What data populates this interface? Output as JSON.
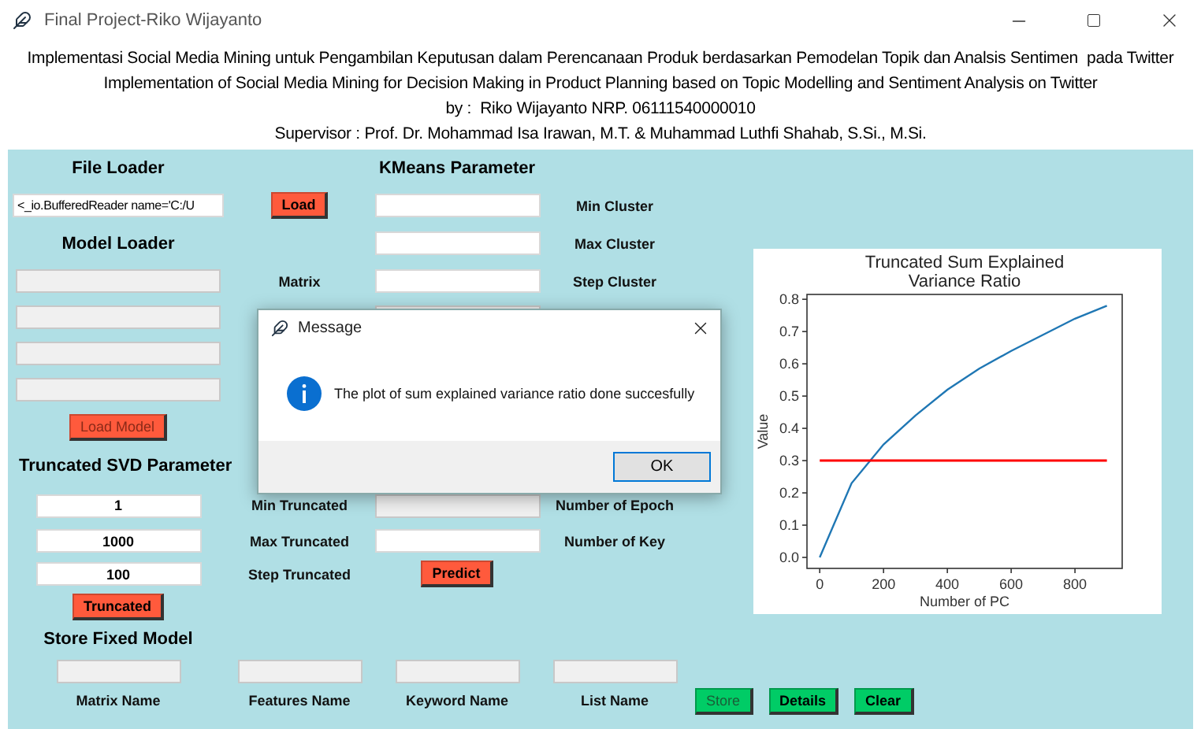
{
  "window": {
    "title": "Final Project-Riko Wijayanto"
  },
  "header": [
    "Implementasi Social Media Mining untuk Pengambilan Keputusan dalam Perencanaan Produk berdasarkan Pemodelan Topik dan Analsis Sentimen  pada Twitter",
    "Implementation of Social Media Mining for Decision Making in Product Planning based on Topic Modelling and Sentiment Analysis on Twitter",
    "by :  Riko Wijayanto NRP. 06111540000010",
    "Supervisor : Prof. Dr. Mohammad Isa Irawan, M.T. & Muhammad Luthfi Shahab, S.Si., M.Si."
  ],
  "file_loader": {
    "heading": "File Loader",
    "path_value": "<_io.BufferedReader name='C:/U",
    "load_button": {
      "label": "Load",
      "disabled": false
    }
  },
  "model_loader": {
    "heading": "Model Loader",
    "fields": [
      {
        "disabled": true
      },
      {
        "disabled": true
      },
      {
        "disabled": true
      },
      {
        "disabled": true
      }
    ],
    "load_button": {
      "label": "Load Model",
      "disabled": true
    }
  },
  "kmeans": {
    "heading": "KMeans Parameter",
    "matrix_label": "Matrix",
    "fields": [
      {
        "label": "Min Cluster",
        "disabled": false
      },
      {
        "label": "Max Cluster",
        "disabled": false
      },
      {
        "label": "Step Cluster",
        "disabled": false
      },
      {
        "disabled": true
      },
      {
        "label": "Number of Epoch",
        "disabled": true
      },
      {
        "label": "Number of Key",
        "disabled": false
      }
    ],
    "predict_button": {
      "label": "Predict",
      "disabled": false
    }
  },
  "truncated_svd": {
    "heading": "Truncated SVD Parameter",
    "rows": [
      {
        "value": "1",
        "label": "Min Truncated"
      },
      {
        "value": "1000",
        "label": "Max Truncated"
      },
      {
        "value": "100",
        "label": "Step Truncated"
      }
    ],
    "button": {
      "label": "Truncated",
      "disabled": false
    }
  },
  "store_fixed_model": {
    "heading": "Store Fixed Model",
    "fields": [
      {
        "label": "Matrix Name",
        "disabled": true
      },
      {
        "label": "Features Name",
        "disabled": true
      },
      {
        "label": "Keyword Name",
        "disabled": true
      },
      {
        "label": "List Name",
        "disabled": true
      }
    ],
    "buttons": [
      {
        "label": "Store",
        "disabled": true
      },
      {
        "label": "Details",
        "disabled": false
      },
      {
        "label": "Clear",
        "disabled": false
      }
    ]
  },
  "chart_data": {
    "type": "line",
    "title": "Truncated Sum Explained Variance Ratio",
    "xlabel": "Number of PC",
    "ylabel": "Value",
    "x": [
      0,
      100,
      200,
      300,
      400,
      500,
      600,
      700,
      800,
      900
    ],
    "series": [
      {
        "color": "#1f77b4",
        "values": [
          0.0,
          0.23,
          0.35,
          0.44,
          0.52,
          0.585,
          0.64,
          0.69,
          0.74,
          0.78
        ]
      },
      {
        "color": "#ff0000",
        "values": [
          0.3,
          0.3,
          0.3,
          0.3,
          0.3,
          0.3,
          0.3,
          0.3,
          0.3,
          0.3
        ]
      }
    ],
    "xlim": [
      -40,
      948
    ],
    "ylim": [
      -0.034,
      0.815
    ],
    "xticks": [
      0,
      200,
      400,
      600,
      800
    ],
    "yticks": [
      {
        "value": 0,
        "label": "0.0"
      },
      {
        "value": 0.1,
        "label": "0.1"
      },
      {
        "value": 0.2,
        "label": "0.2"
      },
      {
        "value": 0.3,
        "label": "0.3"
      },
      {
        "value": 0.4,
        "label": "0.4"
      },
      {
        "value": 0.5,
        "label": "0.5"
      },
      {
        "value": 0.6,
        "label": "0.6"
      },
      {
        "value": 0.7,
        "label": "0.7"
      },
      {
        "value": 0.8,
        "label": "0.8"
      }
    ]
  },
  "dialog": {
    "title": "Message",
    "message": "The plot of sum explained variance ratio done succesfully",
    "button": "OK"
  }
}
